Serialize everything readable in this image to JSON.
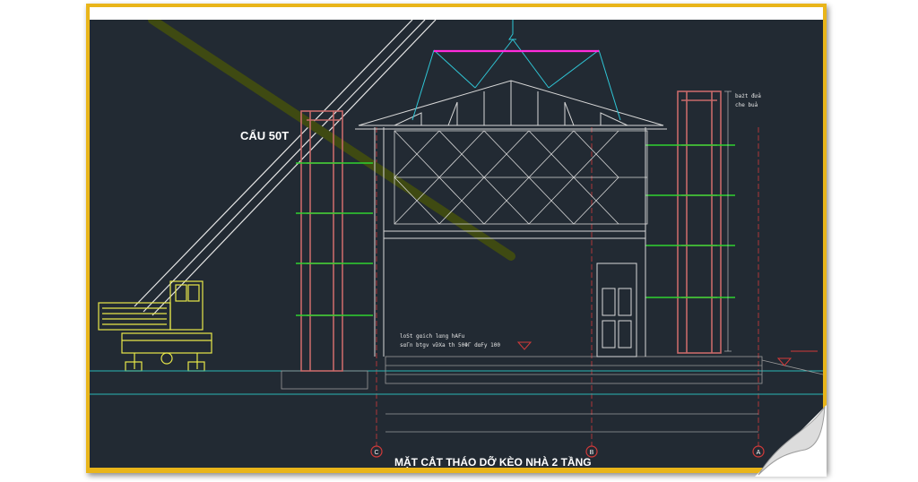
{
  "drawing": {
    "crane_label": "CẨU 50T",
    "title": "MẶT CẮT THÁO DỠ KÈO NHÀ 2 TẦNG",
    "annotations": {
      "scaffold_note_1": "bażt đửa",
      "scaffold_note_2": "che buả",
      "floor_note_1": "lοSt gαich lαng hAFu",
      "floor_note_2": "sαΓn btgv vữXa th 50ΦΓ dαFy 100"
    },
    "grid_markers": [
      "C",
      "B",
      "A"
    ]
  },
  "colors": {
    "frame": "#e9b51a",
    "background": "#222a33",
    "structure": "#d8d8d8",
    "scaffold": "#c86a6a",
    "ledger": "#2fd12f",
    "rigging": "#2fc6d6",
    "spreader_bar": "#ff2bdc",
    "crane_body": "#e8e84a",
    "ground": "#29b5b5",
    "marker": "#d23a3a"
  }
}
